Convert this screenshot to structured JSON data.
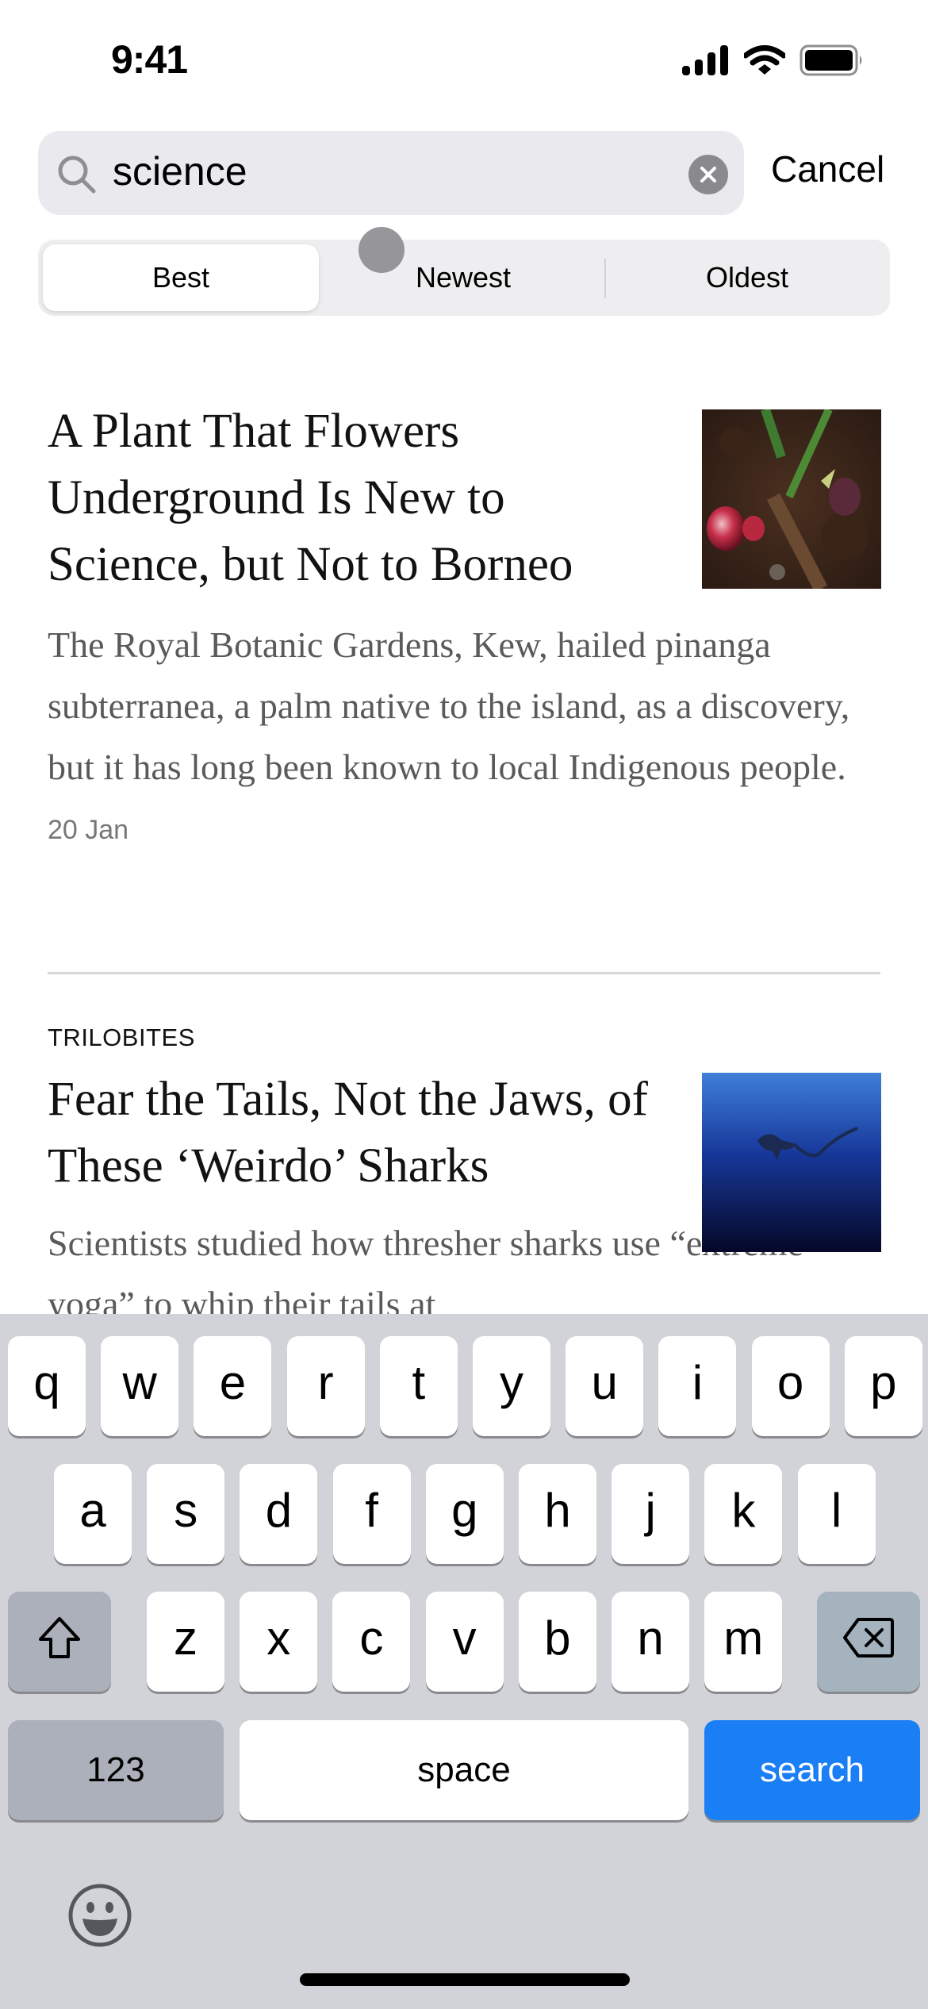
{
  "status_bar": {
    "time": "9:41",
    "icons": [
      "cellular-signal-icon",
      "wifi-icon",
      "battery-icon"
    ]
  },
  "search": {
    "query": "science",
    "icon": "search-icon",
    "clear_icon": "clear-icon",
    "cancel_label": "Cancel"
  },
  "sort": {
    "selected": "Best",
    "options": [
      "Best",
      "Newest",
      "Oldest"
    ]
  },
  "articles": [
    {
      "kicker": "",
      "headline": "A Plant That Flowers Underground Is New to Science, but Not to Borneo",
      "summary": "The Royal Botanic Gardens, Kew, hailed pinanga subterranea, a palm native to the island, as a discovery, but it has long been known to local Indigenous people.",
      "date": "20 Jan",
      "thumbnail": "plant-in-soil-photo"
    },
    {
      "kicker": "TRILOBITES",
      "headline": "Fear the Tails, Not the Jaws, of These ‘Weirdo’ Sharks",
      "summary": "Scientists studied how thresher sharks use “extreme yoga” to whip their tails at",
      "thumbnail": "thresher-shark-photo"
    }
  ],
  "keyboard": {
    "row1": [
      "q",
      "w",
      "e",
      "r",
      "t",
      "y",
      "u",
      "i",
      "o",
      "p"
    ],
    "row2": [
      "a",
      "s",
      "d",
      "f",
      "g",
      "h",
      "j",
      "k",
      "l"
    ],
    "row3": [
      "z",
      "x",
      "c",
      "v",
      "b",
      "n",
      "m"
    ],
    "numbers_label": "123",
    "space_label": "space",
    "search_label": "search",
    "shift_icon": "shift-icon",
    "delete_icon": "delete-icon",
    "emoji_icon": "emoji-icon",
    "accent_color": "#1a7ff5"
  }
}
